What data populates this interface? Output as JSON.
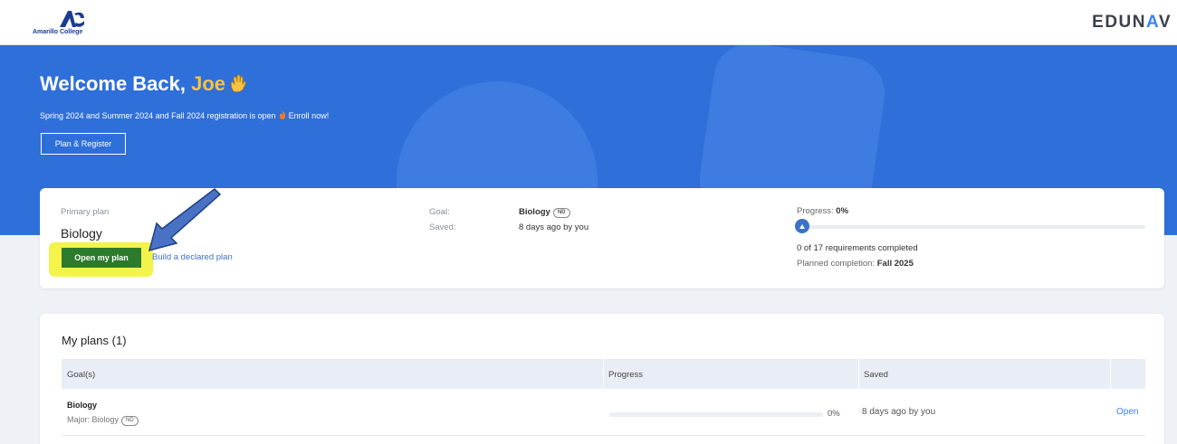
{
  "header": {
    "logo_text": "Amarillo College",
    "brand_prefix": "EDUN",
    "brand_accent": "A",
    "brand_suffix": "V"
  },
  "hero": {
    "greeting": "Welcome Back, ",
    "name": "Joe",
    "announcement": "Spring 2024 and Summer 2024 and Fall 2024 registration is open",
    "announcement_cta": "Enroll now!",
    "plan_register_label": "Plan & Register"
  },
  "primary_plan": {
    "label": "Primary plan",
    "title": "Biology",
    "open_button": "Open my plan",
    "declared_link": "Build a declared plan",
    "goal_label": "Goal:",
    "goal_value": "Biology",
    "goal_badge": "ND",
    "saved_label": "Saved:",
    "saved_value": "8 days ago by you",
    "progress_label": "Progress:",
    "progress_value": "0%",
    "progress_fraction": 0,
    "requirements": "0 of 17 requirements completed",
    "completion_label": "Planned completion:",
    "completion_value": "Fall 2025"
  },
  "my_plans": {
    "title": "My plans (1)",
    "columns": [
      "Goal(s)",
      "Progress",
      "Saved"
    ],
    "rows": [
      {
        "goal": "Biology",
        "major": "Major: Biology",
        "badge": "ND",
        "progress": "0%",
        "saved": "8 days ago by you",
        "action": "Open"
      }
    ]
  },
  "colors": {
    "hero_bg": "#2f6fd9",
    "accent_name": "#f6c343",
    "open_button": "#2c7a2c",
    "highlight": "#f3f34a",
    "link": "#3b72c8"
  }
}
